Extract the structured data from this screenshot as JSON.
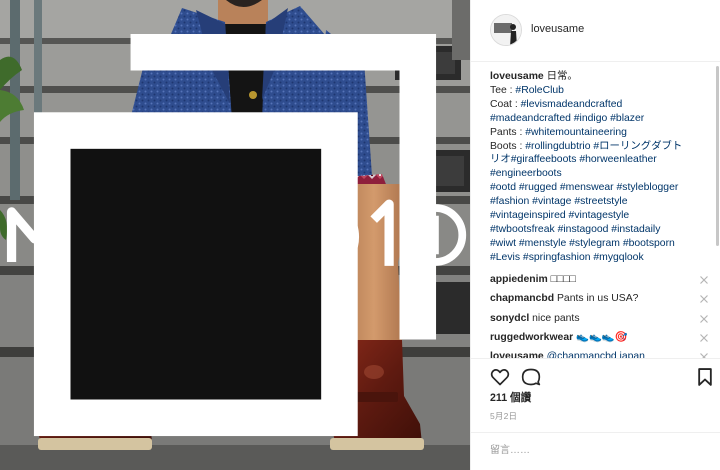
{
  "watermark": "MOBILE01",
  "post": {
    "username": "loveusame",
    "caption_lines": [
      [
        {
          "t": "loveusame",
          "k": "user"
        },
        {
          "t": " 日常。",
          "k": "text"
        }
      ],
      [
        {
          "t": "Tee : ",
          "k": "text"
        },
        {
          "t": "#RoleClub",
          "k": "tag"
        }
      ],
      [
        {
          "t": "Coat : ",
          "k": "text"
        },
        {
          "t": "#levismadeandcrafted",
          "k": "tag"
        }
      ],
      [
        {
          "t": "#madeandcrafted #indigo #blazer",
          "k": "tag"
        }
      ],
      [
        {
          "t": "Pants : ",
          "k": "text"
        },
        {
          "t": "#whitemountaineering",
          "k": "tag"
        }
      ],
      [
        {
          "t": "Boots : ",
          "k": "text"
        },
        {
          "t": "#rollingdubtrio #ローリングダブト",
          "k": "tag"
        }
      ],
      [
        {
          "t": "リオ#giraffeeboots #horweenleather",
          "k": "tag"
        }
      ],
      [
        {
          "t": "#engineerboots",
          "k": "tag"
        }
      ],
      [
        {
          "t": "#ootd #rugged #menswear #styleblogger",
          "k": "tag"
        }
      ],
      [
        {
          "t": "#fashion #vintage #streetstyle",
          "k": "tag"
        }
      ],
      [
        {
          "t": "#vintageinspired #vintagestyle",
          "k": "tag"
        }
      ],
      [
        {
          "t": "#twbootsfreak #instagood #instadaily",
          "k": "tag"
        }
      ],
      [
        {
          "t": "#wiwt #menstyle #stylegram #bootsporn",
          "k": "tag"
        }
      ],
      [
        {
          "t": "#Levis #springfashion #mygqlook",
          "k": "tag"
        }
      ]
    ],
    "comments": [
      {
        "user": "appiedenim",
        "text": " □□□□",
        "mention": ""
      },
      {
        "user": "chapmancbd",
        "text": " Pants in us USA?",
        "mention": ""
      },
      {
        "user": "sonydcl",
        "text": " nice pants",
        "mention": ""
      },
      {
        "user": "ruggedworkwear",
        "text": " 👟👟👟🎯",
        "mention": ""
      },
      {
        "user": "loveusame",
        "text": " ",
        "mention": "@chapmancbd japan"
      }
    ],
    "likes": "211 個讚",
    "date": "5月2日",
    "comment_placeholder": "留言……"
  },
  "icons": {
    "like": "heart-outline-icon",
    "comment": "speech-bubble-icon",
    "save": "bookmark-icon",
    "delete": "close-icon",
    "post_type": "carousel-icon"
  },
  "colors": {
    "tag": "#003569",
    "text": "#262626",
    "muted": "#999999",
    "border": "#efefef"
  }
}
